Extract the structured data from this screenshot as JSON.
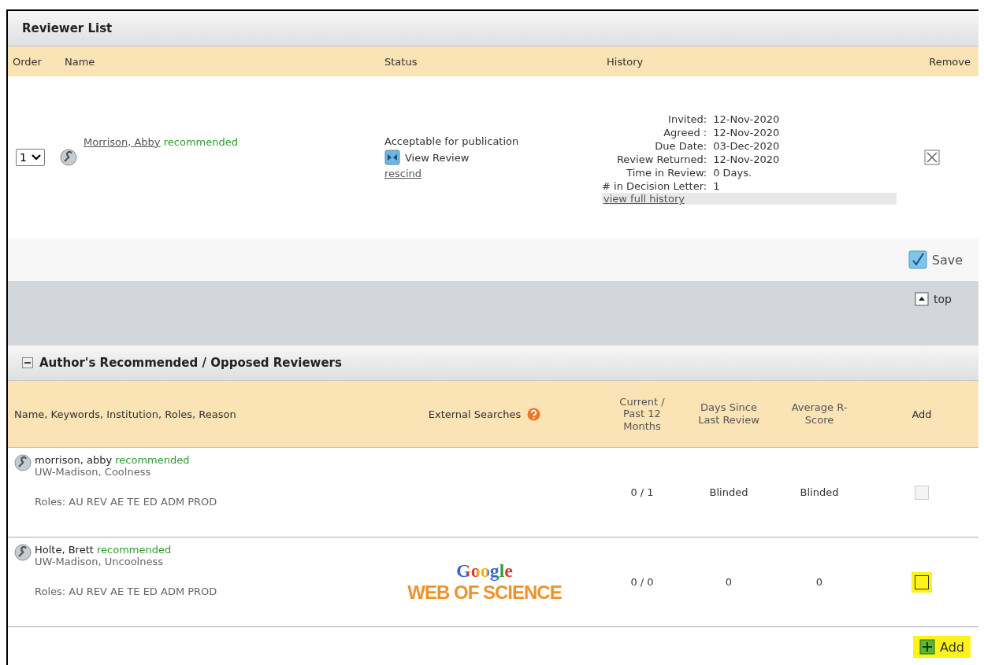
{
  "reviewer_list": {
    "title": "Reviewer List",
    "columns": [
      "Order",
      "Name",
      "Status",
      "History",
      "Remove"
    ],
    "rows": [
      {
        "order": "1",
        "name": "Morrison, Abby",
        "tag": "recommended",
        "status": "Acceptable for publication",
        "view_review": "View Review",
        "rescind": "rescind",
        "history": [
          {
            "label": "Invited:",
            "value": "12-Nov-2020"
          },
          {
            "label": "Agreed :",
            "value": "12-Nov-2020"
          },
          {
            "label": "Due Date:",
            "value": "03-Dec-2020"
          },
          {
            "label": "Review Returned:",
            "value": "12-Nov-2020"
          },
          {
            "label": "Time in Review:",
            "value": "0 Days."
          },
          {
            "label": "# in Decision Letter:",
            "value": "1"
          }
        ],
        "full_history": "view full history"
      }
    ],
    "save": "Save"
  },
  "top_link": "top",
  "recommended": {
    "title": "Author's Recommended / Opposed Reviewers",
    "expanded": true,
    "columns": [
      "Name, Keywords, Institution, Roles, Reason",
      "External Searches",
      "Current / Past 12 Months",
      "Days Since Last Review",
      "Average R-Score",
      "Add"
    ],
    "rows": [
      {
        "name": "morrison, abby",
        "tag": "recommended",
        "institution": "UW-Madison, Coolness",
        "roles": "Roles: AU REV AE TE ED ADM PROD",
        "searches": [],
        "count": "0 / 1",
        "days": "Blinded",
        "score": "Blinded",
        "checked": false,
        "disabled": true,
        "highlighted": false
      },
      {
        "name": "Holte, Brett",
        "tag": "recommended",
        "institution": "UW-Madison, Uncoolness",
        "roles": "Roles: AU REV AE TE ED ADM PROD",
        "searches": [
          "Google",
          "WEB OF SCIENCE"
        ],
        "count": "0 / 0",
        "days": "0",
        "score": "0",
        "checked": false,
        "disabled": false,
        "highlighted": true
      }
    ],
    "add": {
      "label": "Add",
      "highlighted": true
    }
  }
}
